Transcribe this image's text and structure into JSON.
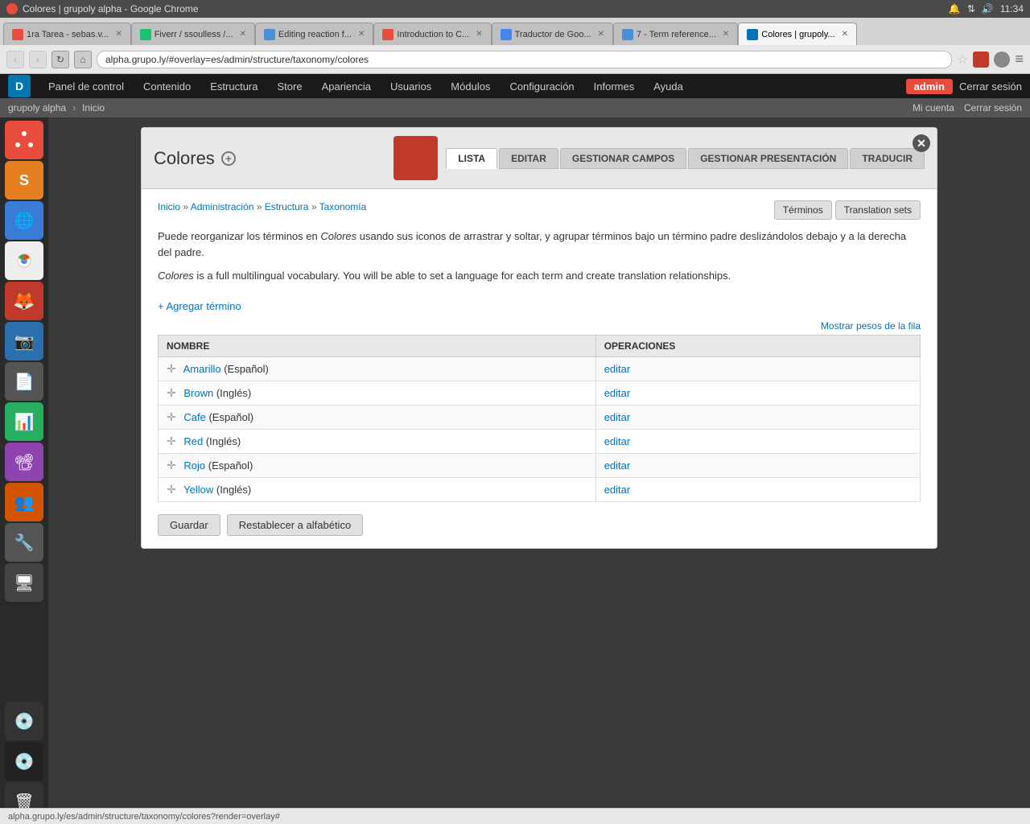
{
  "browser": {
    "title": "Colores | grupoly alpha - Google Chrome",
    "time": "11:34",
    "tabs": [
      {
        "id": "tab-1",
        "label": "1ra Tarea - sebas.v...",
        "favicon_color": "#e74c3c",
        "active": false
      },
      {
        "id": "tab-2",
        "label": "Fiverr / ssoulless /...",
        "favicon_color": "#1dbf73",
        "active": false
      },
      {
        "id": "tab-3",
        "label": "Editing reaction f...",
        "favicon_color": "#4a90d9",
        "active": false
      },
      {
        "id": "tab-4",
        "label": "Introduction to C...",
        "favicon_color": "#e74c3c",
        "active": false
      },
      {
        "id": "tab-5",
        "label": "Traductor de Goo...",
        "favicon_color": "#4285f4",
        "active": false
      },
      {
        "id": "tab-6",
        "label": "7 - Term reference...",
        "favicon_color": "#4a90d9",
        "active": false
      },
      {
        "id": "tab-7",
        "label": "Colores | grupoly...",
        "favicon_color": "#0073ba",
        "active": true
      }
    ],
    "address": "alpha.grupo.ly/#overlay=es/admin/structure/taxonomy/colores",
    "status_bar": "alpha.grupo.ly/es/admin/structure/taxonomy/colores?render=overlay#"
  },
  "admin_bar": {
    "logo": "D",
    "items": [
      "Panel de control",
      "Contenido",
      "Estructura",
      "Store",
      "Apariencia",
      "Usuarios",
      "Módulos",
      "Configuración",
      "Informes",
      "Ayuda"
    ],
    "admin_label": "admin",
    "cerrar_sesion": "Cerrar sesión"
  },
  "secondary_nav": {
    "site_name": "grupoly alpha",
    "inicio": "Inicio",
    "mi_cuenta": "Mi cuenta",
    "cerrar_sesion": "Cerrar sesión"
  },
  "page": {
    "title": "Colores",
    "tabs": [
      {
        "id": "lista",
        "label": "LISTA",
        "active": true
      },
      {
        "id": "editar",
        "label": "EDITAR",
        "active": false
      },
      {
        "id": "gestionar-campos",
        "label": "GESTIONAR CAMPOS",
        "active": false
      },
      {
        "id": "gestionar-presentacion",
        "label": "GESTIONAR PRESENTACIÓN",
        "active": false
      },
      {
        "id": "traducir",
        "label": "TRADUCIR",
        "active": false
      }
    ],
    "breadcrumb": {
      "items": [
        "Inicio",
        "Administración",
        "Estructura",
        "Taxonomía"
      ]
    },
    "action_buttons": {
      "terminos": "Términos",
      "translation_sets": "Translation sets"
    },
    "description1": "Puede reorganizar los términos en Colores usando sus iconos de arrastrar y soltar, y agrupar términos bajo un término padre deslizándolos debajo y a la derecha del padre.",
    "description1_italic": "Colores",
    "description2": "Colores is a full multilingual vocabulary. You will be able to set a language for each term and create translation relationships.",
    "description2_italic": "Colores",
    "add_term_label": "+ Agregar término",
    "show_weights_label": "Mostrar pesos de la fila",
    "table": {
      "columns": [
        "NOMBRE",
        "OPERACIONES"
      ],
      "rows": [
        {
          "term": "Amarillo",
          "lang": "(Español)",
          "operation": "editar"
        },
        {
          "term": "Brown",
          "lang": "(Inglés)",
          "operation": "editar"
        },
        {
          "term": "Cafe",
          "lang": "(Español)",
          "operation": "editar"
        },
        {
          "term": "Red",
          "lang": "(Inglés)",
          "operation": "editar"
        },
        {
          "term": "Rojo",
          "lang": "(Español)",
          "operation": "editar"
        },
        {
          "term": "Yellow",
          "lang": "(Inglés)",
          "operation": "editar"
        }
      ]
    },
    "buttons": {
      "guardar": "Guardar",
      "restablecer": "Restablecer a alfabético"
    }
  }
}
